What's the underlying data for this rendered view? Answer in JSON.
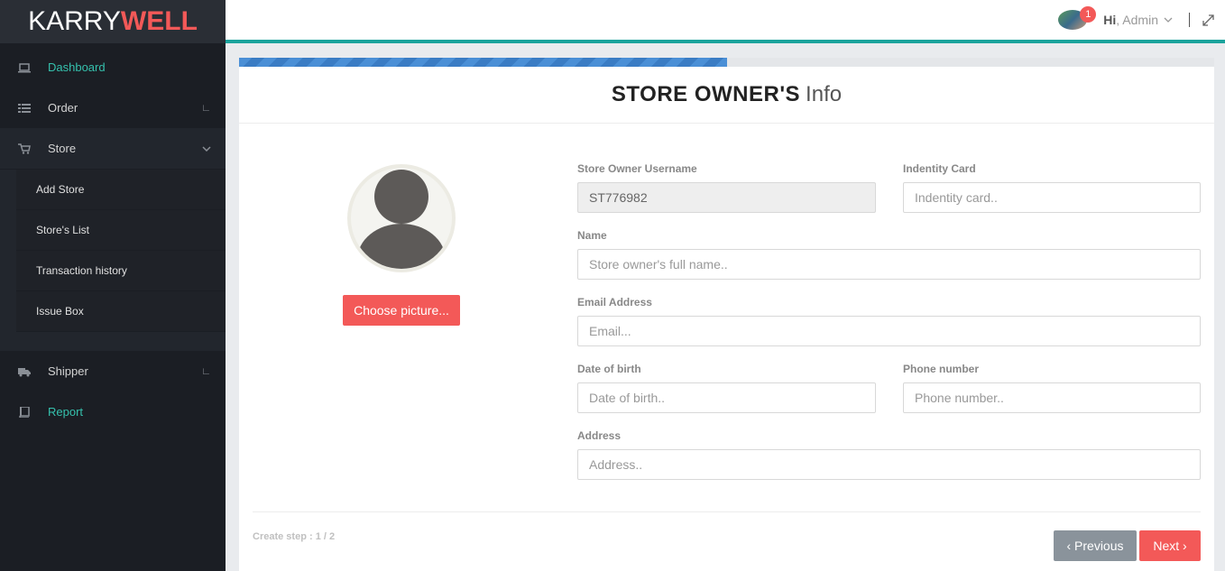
{
  "brand": {
    "part1": "KARRY",
    "part2": "WELL"
  },
  "sidebar": {
    "items": [
      {
        "label": "Dashboard",
        "icon": "laptop-icon"
      },
      {
        "label": "Order",
        "icon": "list-icon"
      },
      {
        "label": "Store",
        "icon": "cart-icon"
      },
      {
        "label": "Shipper",
        "icon": "truck-icon"
      },
      {
        "label": "Report",
        "icon": "book-icon"
      }
    ],
    "store_submenu": [
      "Add Store",
      "Store's List",
      "Transaction history",
      "Issue Box"
    ]
  },
  "header": {
    "notification_count": "1",
    "greeting_hi": "Hi",
    "greeting_name": ", Admin"
  },
  "form": {
    "title_strong": "STORE OWNER'S",
    "title_light": "Info",
    "choose_picture": "Choose picture...",
    "fields": {
      "username": {
        "label": "Store Owner Username",
        "value": "ST776982"
      },
      "identity": {
        "label": "Indentity Card",
        "placeholder": "Indentity card.."
      },
      "name": {
        "label": "Name",
        "placeholder": "Store owner's full name.."
      },
      "email": {
        "label": "Email Address",
        "placeholder": "Email..."
      },
      "dob": {
        "label": "Date of birth",
        "placeholder": "Date of birth.."
      },
      "phone": {
        "label": "Phone number",
        "placeholder": "Phone number.."
      },
      "address": {
        "label": "Address",
        "placeholder": "Address.."
      }
    },
    "step_text": "Create step : 1 / 2",
    "previous": "‹ Previous",
    "next": "Next ›",
    "progress_fraction": 0.5
  },
  "colors": {
    "accent_teal": "#1ba39c",
    "accent_red": "#f35958",
    "sidebar_bg": "#1b1e24"
  }
}
